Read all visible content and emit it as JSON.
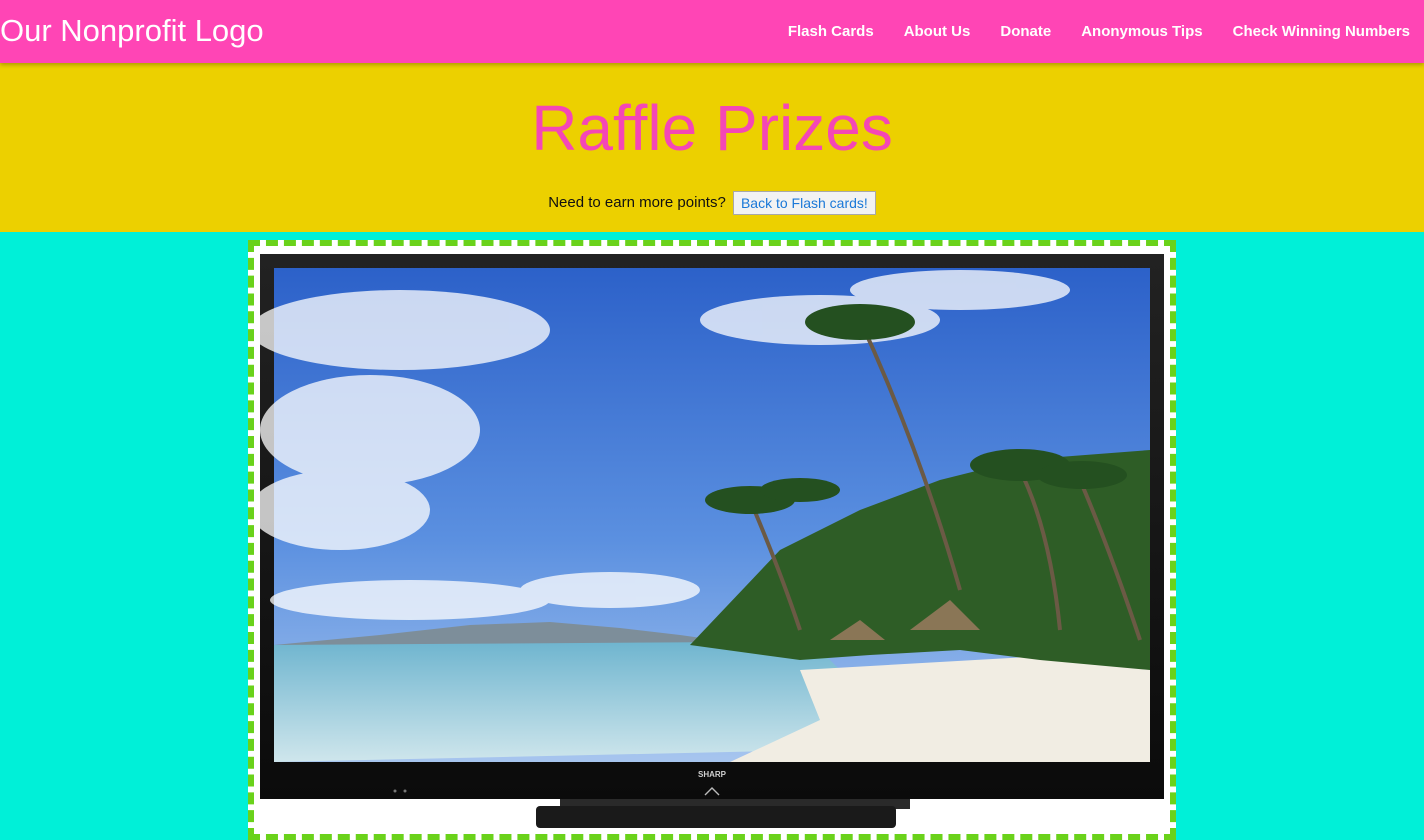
{
  "nav": {
    "brand": "Our Nonprofit Logo",
    "links": [
      "Flash Cards",
      "About Us",
      "Donate",
      "Anonymous Tips",
      "Check Winning Numbers"
    ]
  },
  "hero": {
    "title": "Raffle Prizes",
    "prompt": "Need to earn more points?",
    "button": "Back to Flash cards!"
  },
  "prize": {
    "brand_text": "SHARP",
    "image_desc_icon": "tv-icon"
  },
  "colors": {
    "navbar": "#ff45b5",
    "hero": "#ecd000",
    "title": "#f447b6",
    "page": "#00f0d8",
    "frame_border": "#6ad21a"
  }
}
